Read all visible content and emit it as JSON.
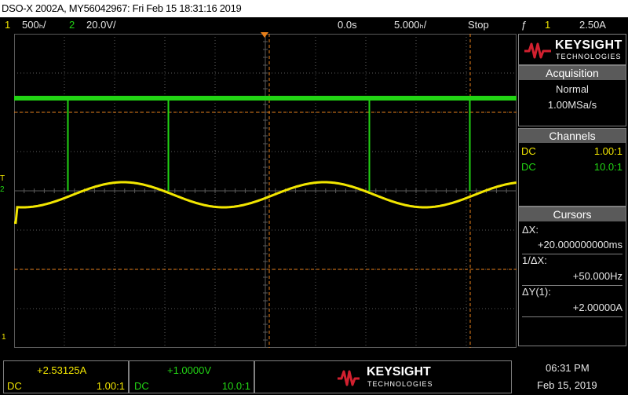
{
  "title": "DSO-X 2002A, MY56042967: Fri Feb 15 18:31:16 2019",
  "status": {
    "ch1_num": "1",
    "ch1_scale": "500ₕ/",
    "ch2_num": "2",
    "ch2_scale": "20.0V/",
    "delay": "0.0s",
    "timebase": "5.000ₕ/",
    "run_state": "Stop",
    "trigger_symbol": "ƒ",
    "trigger_channel": "1",
    "trigger_level": "2.50A"
  },
  "brand": {
    "name": "KEYSIGHT",
    "sub": "TECHNOLOGIES"
  },
  "acquisition": {
    "header": "Acquisition",
    "mode": "Normal",
    "rate": "1.00MSa/s"
  },
  "channels": {
    "header": "Channels",
    "rows": [
      {
        "coupling": "DC",
        "probe": "1.00:1",
        "color": "#f2e600"
      },
      {
        "coupling": "DC",
        "probe": "10.0:1",
        "color": "#22d414"
      }
    ]
  },
  "cursors": {
    "header": "Cursors",
    "dx_label": "ΔX:",
    "dx_value": "+20.000000000ms",
    "inv_dx_label": "1/ΔX:",
    "inv_dx_value": "+50.000Hz",
    "dy_label": "ΔY(1):",
    "dy_value": "+2.00000A"
  },
  "markers": {
    "ch2_ground": "2",
    "trigger_level_marker": "T",
    "ch1_ground": "1"
  },
  "bottom": {
    "ch1_value": "+2.53125A",
    "ch1_coupling": "DC",
    "ch1_probe": "1.00:1",
    "ch2_value": "+1.0000V",
    "ch2_coupling": "DC",
    "ch2_probe": "10.0:1",
    "time": "06:31 PM",
    "date": "Feb 15, 2019"
  },
  "colors": {
    "ch1": "#f2e600",
    "ch2": "#22d414",
    "cursor": "#e8801a",
    "grid": "#5a5a5a",
    "brand_red": "#d2202f"
  },
  "waveform": {
    "ch1_period_ms": 20,
    "ch2_pulse_interval_ms": 10
  }
}
